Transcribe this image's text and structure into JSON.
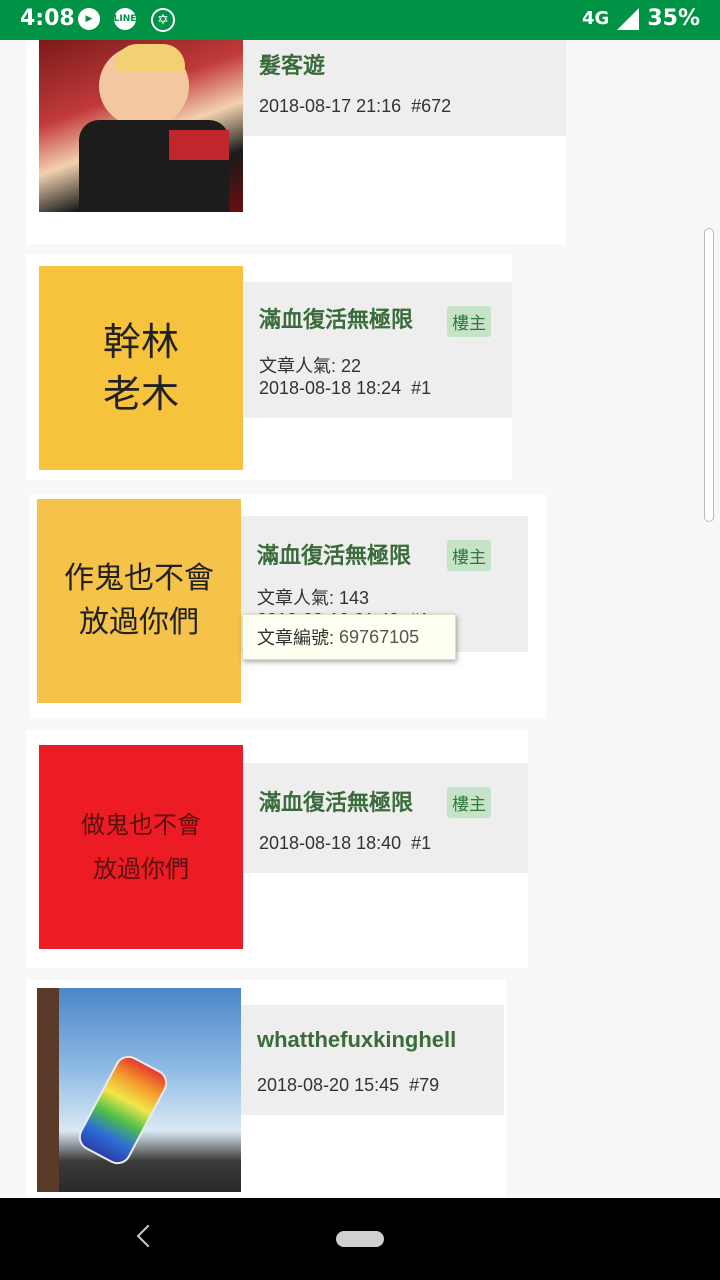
{
  "status_bar": {
    "time": "4:08",
    "network": "4G",
    "battery": "35%",
    "icons": [
      "play-icon",
      "line-icon",
      "star-of-david-icon",
      "signal-icon"
    ]
  },
  "posts": [
    {
      "name": "髮客遊",
      "timestamp": "2018-08-17 21:16",
      "floor": "#672",
      "avatar": "child-cheering-photo"
    },
    {
      "name": "滿血復活無極限",
      "badge": "樓主",
      "popularity_label": "文章人氣: 22",
      "timestamp": "2018-08-18 18:24",
      "floor": "#1",
      "avatar_lines": [
        "幹林",
        "老木"
      ],
      "avatar_bg": "#f7c23c"
    },
    {
      "name": "滿血復活無極限",
      "badge": "樓主",
      "popularity_label": "文章人氣: 143",
      "timestamp": "2018-08-18 21:49",
      "floor": "#1",
      "avatar_lines": [
        "作鬼也不會",
        "放過你們"
      ],
      "avatar_bg": "#f5c24a",
      "tooltip": {
        "label": "文章編號:",
        "value": "69767105"
      }
    },
    {
      "name": "滿血復活無極限",
      "badge": "樓主",
      "timestamp": "2018-08-18 18:40",
      "floor": "#1",
      "avatar_lines": [
        "做鬼也不會",
        "放過你們"
      ],
      "avatar_bg": "#ed1c24"
    },
    {
      "name": "whatthefuxkinghell",
      "timestamp": "2018-08-20 15:45",
      "floor": "#79",
      "avatar": "rainbow-bottle-photo"
    }
  ],
  "colors": {
    "status_bar": "#009245",
    "name_text": "#3a6b3a",
    "badge_bg": "#c6e3c8",
    "info_bg": "#eeeeee"
  }
}
